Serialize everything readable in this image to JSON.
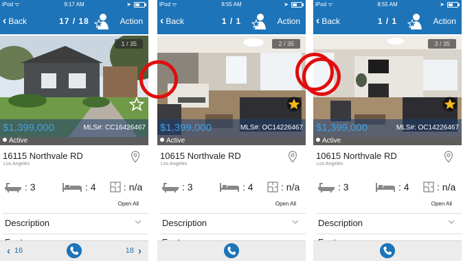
{
  "colors": {
    "nav_blue": "#1d74b9",
    "price_blue": "#3ea1e6",
    "status_gray": "#5c5c5c",
    "highlight_red": "#e10d0d"
  },
  "screens": [
    {
      "status": {
        "carrier": "iPod ᯤ",
        "time": "9:17 AM"
      },
      "nav": {
        "back_label": "Back",
        "count": "17 / 18",
        "action_label": "Action"
      },
      "photo": {
        "counter": "1 / 35",
        "scene": "exterior-house",
        "favorite": false
      },
      "listing": {
        "price": "$1,399,000",
        "mls": "MLS#: CC16426467",
        "status": "Active",
        "address": "16115 Northvale RD",
        "city": "Los Angeles",
        "baths": ": 3",
        "beds": ": 4",
        "size": ": n/a",
        "open_all": "Open All",
        "description": "Description",
        "features": "Features"
      },
      "toolbar": {
        "prev": "16",
        "next": "18"
      }
    },
    {
      "status": {
        "carrier": "iPod ᯤ",
        "time": "8:55 AM"
      },
      "nav": {
        "back_label": "Back",
        "count": "1 / 1",
        "action_label": "Action"
      },
      "photo": {
        "counter": "2 / 35",
        "scene": "interior-living",
        "favorite": true
      },
      "listing": {
        "price": "$1,399,000",
        "mls": "MLS#: OC14226467",
        "status": "Active",
        "address": "10615 Northvale RD",
        "city": "Los Angeles",
        "baths": ": 3",
        "beds": ": 4",
        "size": ": n/a",
        "open_all": "Open All",
        "description": "Description",
        "features": "Features"
      },
      "toolbar": {
        "prev": "",
        "next": ""
      }
    },
    {
      "status": {
        "carrier": "iPod ᯤ",
        "time": "8:55 AM"
      },
      "nav": {
        "back_label": "Back",
        "count": "1 / 1",
        "action_label": "Action"
      },
      "photo": {
        "counter": "3 / 35",
        "scene": "interior-fireplace",
        "favorite": true
      },
      "listing": {
        "price": "$1,399,000",
        "mls": "MLS#: OC14226467",
        "status": "Active",
        "address": "10615 Northvale RD",
        "city": "Los Angeles",
        "baths": ": 3",
        "beds": ": 4",
        "size": ": n/a",
        "open_all": "Open All",
        "description": "Description",
        "features": "Features"
      },
      "toolbar": {
        "prev": "",
        "next": ""
      }
    }
  ]
}
